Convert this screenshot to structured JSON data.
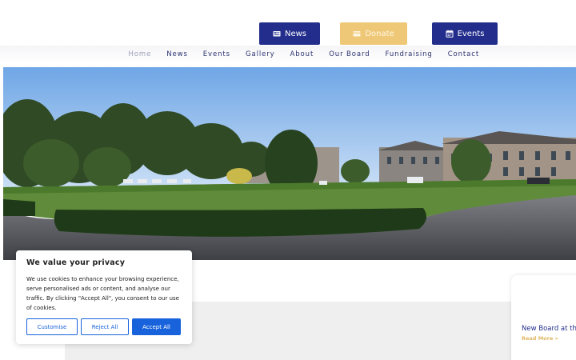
{
  "header": {
    "news_label": "News",
    "donate_label": "Donate",
    "events_label": "Events",
    "colors": {
      "primary": "#232e8c",
      "donate": "#efc877"
    }
  },
  "nav": {
    "items": [
      {
        "label": "Home",
        "active": true
      },
      {
        "label": "News"
      },
      {
        "label": "Events"
      },
      {
        "label": "Gallery"
      },
      {
        "label": "About"
      },
      {
        "label": "Our Board"
      },
      {
        "label": "Fundraising"
      },
      {
        "label": "Contact"
      }
    ]
  },
  "side_card": {
    "title": "New Board at the",
    "read_more": "Read More »"
  },
  "cookie": {
    "title": "We value your privacy",
    "body": "We use cookies to enhance your browsing experience, serve personalised ads or content, and analyse our traffic. By clicking \"Accept All\", you consent to our use of cookies.",
    "customise": "Customise",
    "reject": "Reject All",
    "accept": "Accept All",
    "accent": "#1863dc"
  }
}
